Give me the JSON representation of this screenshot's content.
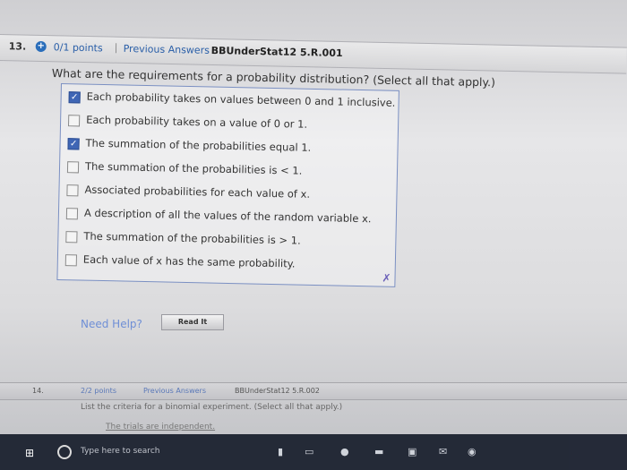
{
  "question13": {
    "number": "13.",
    "points": "0/1 points",
    "separator": "|",
    "previous_answers": "Previous Answers",
    "question_id": "BBUnderStat12 5.R.001",
    "question_text": "What are the requirements for a probability distribution? (Select all that apply.)",
    "options": [
      {
        "label": "Each probability takes on values between 0 and 1 inclusive.",
        "checked": true
      },
      {
        "label": "Each probability takes on a value of 0 or 1.",
        "checked": false
      },
      {
        "label": "The summation of the probabilities equal 1.",
        "checked": true
      },
      {
        "label": "The summation of the probabilities is < 1.",
        "checked": false
      },
      {
        "label": "Associated probabilities for each value of x.",
        "checked": false
      },
      {
        "label": "A description of all the values of the random variable x.",
        "checked": false
      },
      {
        "label": "The summation of the probabilities is > 1.",
        "checked": false
      },
      {
        "label": "Each value of x has the same probability.",
        "checked": false
      }
    ],
    "need_help": "Need Help?",
    "read_it": "Read It"
  },
  "question14": {
    "number": "14.",
    "points": "2/2 points",
    "previous_answers": "Previous Answers",
    "question_id": "BBUnderStat12 5.R.002",
    "question_text": "List the criteria for a binomial experiment. (Select all that apply.)",
    "option_partial": "The trials are independent."
  },
  "taskbar": {
    "search_placeholder": "Type here to search"
  },
  "colors": {
    "checkbox_checked": "#3f66b5",
    "link_blue": "#2a5fa8"
  }
}
